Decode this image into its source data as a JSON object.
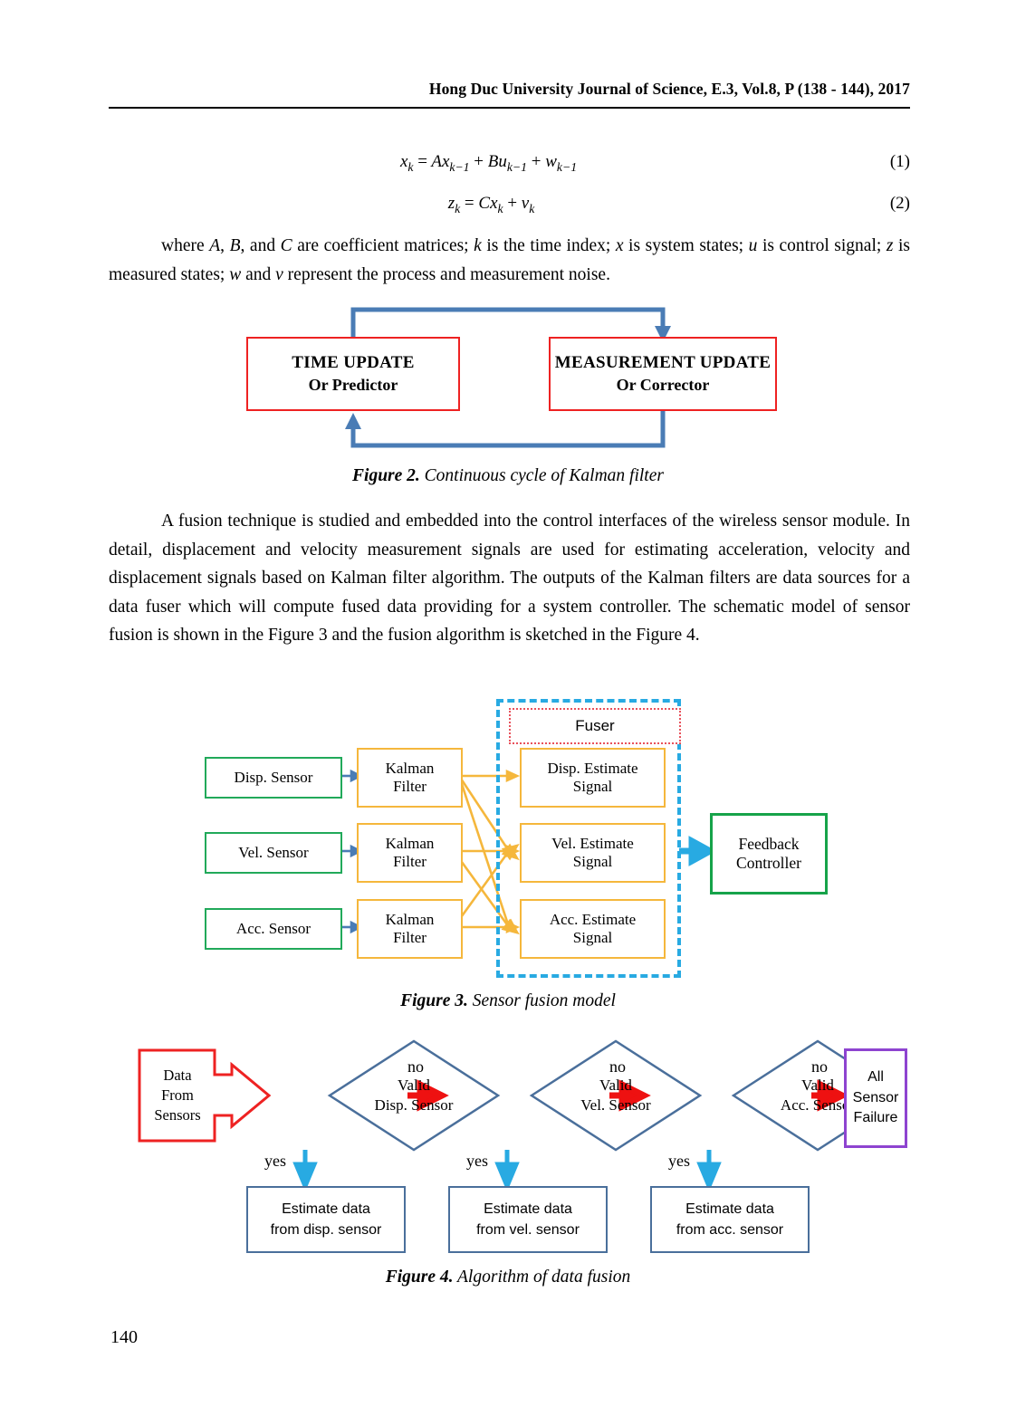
{
  "header": {
    "running_title": "Hong Duc University Journal of Science, E.3, Vol.8, P (138 - 144), 2017"
  },
  "page_number": "140",
  "equations": [
    {
      "id": "1",
      "label": "(1)",
      "text": "x_k = Ax_{k-1} + Bu_{k-1} + w_{k-1}"
    },
    {
      "id": "2",
      "label": "(2)",
      "text": "z_k = Cx_k + v_k"
    }
  ],
  "paragraphs": {
    "where_clause": {
      "lead": "where ",
      "full": "where A, B, and C are coefficient matrices; k is the time index; x is system states; u is control signal; z is measured states; w and v represent the process and measurement noise."
    },
    "fusion": "A fusion technique is studied and embedded into the control interfaces of the wireless sensor module. In detail, displacement and velocity measurement signals are used for estimating acceleration, velocity and displacement signals based on Kalman filter algorithm. The outputs of the Kalman filters are data sources for a data fuser which will compute fused data providing for a system controller. The schematic model of sensor fusion is shown in the Figure 3 and the fusion algorithm is sketched in the Figure 4."
  },
  "figures": {
    "figure2": {
      "caption_bold": "Figure 2.",
      "caption_text": " Continuous cycle of Kalman filter",
      "boxes": [
        {
          "line1": "TIME UPDATE",
          "line2": "Or Predictor"
        },
        {
          "line1": "MEASUREMENT UPDATE",
          "line2": "Or Corrector"
        }
      ],
      "colors": {
        "box_border": "#ee2222",
        "arrow": "#4a7cb5"
      }
    },
    "figure3": {
      "caption_bold": "Figure 3.",
      "caption_text": " Sensor fusion model",
      "sensors": [
        "Disp. Sensor",
        "Vel. Sensor",
        "Acc. Sensor"
      ],
      "filters": [
        "Kalman Filter",
        "Kalman Filter",
        "Kalman Filter"
      ],
      "filter_lines": [
        [
          "Kalman",
          "Filter"
        ],
        [
          "Kalman",
          "Filter"
        ],
        [
          "Kalman",
          "Filter"
        ]
      ],
      "fuser_label": "Fuser",
      "estimates": [
        {
          "line1": "Disp. Estimate",
          "line2": "Signal"
        },
        {
          "line1": "Vel. Estimate",
          "line2": "Signal"
        },
        {
          "line1": "Acc. Estimate",
          "line2": "Signal"
        }
      ],
      "controller": {
        "line1": "Feedback",
        "line2": "Controller"
      },
      "colors": {
        "sensor_border": "#21a95a",
        "filter_border": "#f5b73c",
        "estimate_border": "#f5b73c",
        "fuser_border": "#e8515b",
        "dash_border": "#28aae2",
        "controller_border": "#16a34a",
        "link_line": "#f5b73c",
        "small_arrow": "#4a7cb5",
        "out_arrow": "#28aae2"
      }
    },
    "figure4": {
      "caption_bold": "Figure 4.",
      "caption_text": " Algorithm of data fusion",
      "source": {
        "line1": "Data",
        "line2": "From",
        "line3": "Sensors"
      },
      "decisions": [
        {
          "line1": "Valid",
          "line2": "Disp. Sensor"
        },
        {
          "line1": "Valid",
          "line2": "Vel. Sensor"
        },
        {
          "line1": "Valid",
          "line2": "Acc. Sensor"
        }
      ],
      "no_labels": [
        "no",
        "no",
        "no"
      ],
      "yes_labels": [
        "yes",
        "yes",
        "yes"
      ],
      "outcomes": [
        {
          "line1": "Estimate data",
          "line2": "from disp. sensor"
        },
        {
          "line1": "Estimate data",
          "line2": "from vel. sensor"
        },
        {
          "line1": "Estimate data",
          "line2": "from acc. sensor"
        }
      ],
      "failure": {
        "line1": "All",
        "line2": "Sensor",
        "line3": "Failure"
      },
      "colors": {
        "source_border": "#ee2222",
        "diamond_border": "#4a6f9b",
        "no_arrow": "#ee1111",
        "yes_arrow": "#28aae2",
        "outcome_border": "#4a6f9b",
        "failure_border": "#8e44d0"
      }
    }
  }
}
